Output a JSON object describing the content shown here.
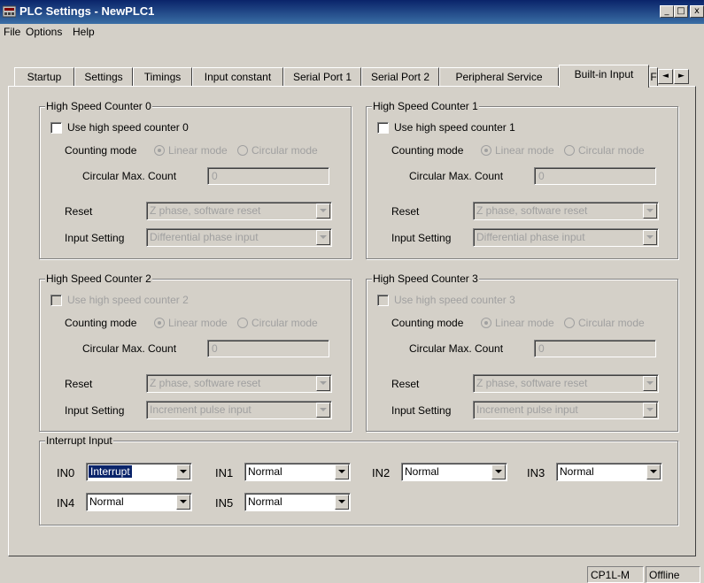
{
  "window": {
    "title": "PLC Settings - NewPLC1",
    "buttons": {
      "minimize": "_",
      "maximize": "□",
      "close": "x"
    }
  },
  "menu": {
    "items": [
      "File",
      "Options",
      "Help"
    ]
  },
  "tabs": [
    "Startup",
    "Settings",
    "Timings",
    "Input constant",
    "Serial Port 1",
    "Serial Port 2",
    "Peripheral Service",
    "Built-in Input",
    "F"
  ],
  "tab_scroll": {
    "left": "◄",
    "right": "►"
  },
  "counters": [
    {
      "legend": "High Speed Counter 0",
      "use_label": "Use high speed counter 0",
      "use_enabled": true,
      "counting_mode_label": "Counting mode",
      "linear_label": "Linear mode",
      "circular_label": "Circular mode",
      "max_count_label": "Circular Max. Count",
      "max_count_value": "0",
      "reset_label": "Reset",
      "reset_value": "Z phase, software reset",
      "input_setting_label": "Input Setting",
      "input_setting_value": "Differential phase input"
    },
    {
      "legend": "High Speed Counter 1",
      "use_label": "Use high speed counter 1",
      "use_enabled": true,
      "counting_mode_label": "Counting mode",
      "linear_label": "Linear mode",
      "circular_label": "Circular mode",
      "max_count_label": "Circular Max. Count",
      "max_count_value": "0",
      "reset_label": "Reset",
      "reset_value": "Z phase, software reset",
      "input_setting_label": "Input Setting",
      "input_setting_value": "Differential phase input"
    },
    {
      "legend": "High Speed Counter 2",
      "use_label": "Use high speed counter 2",
      "use_enabled": false,
      "counting_mode_label": "Counting mode",
      "linear_label": "Linear mode",
      "circular_label": "Circular mode",
      "max_count_label": "Circular Max. Count",
      "max_count_value": "0",
      "reset_label": "Reset",
      "reset_value": "Z phase, software reset",
      "input_setting_label": "Input Setting",
      "input_setting_value": "Increment pulse input"
    },
    {
      "legend": "High Speed Counter 3",
      "use_label": "Use high speed counter 3",
      "use_enabled": false,
      "counting_mode_label": "Counting mode",
      "linear_label": "Linear mode",
      "circular_label": "Circular mode",
      "max_count_label": "Circular Max. Count",
      "max_count_value": "0",
      "reset_label": "Reset",
      "reset_value": "Z phase, software reset",
      "input_setting_label": "Input Setting",
      "input_setting_value": "Increment pulse input"
    }
  ],
  "interrupt": {
    "legend": "Interrupt Input",
    "inputs": [
      {
        "label": "IN0",
        "value": "Interrupt"
      },
      {
        "label": "IN1",
        "value": "Normal"
      },
      {
        "label": "IN2",
        "value": "Normal"
      },
      {
        "label": "IN3",
        "value": "Normal"
      },
      {
        "label": "IN4",
        "value": "Normal"
      },
      {
        "label": "IN5",
        "value": "Normal"
      }
    ]
  },
  "status": {
    "model": "CP1L-M",
    "connection": "Offline"
  },
  "colors": {
    "titlebar": "#0a246a",
    "face": "#d4d0c8",
    "selection": "#0a246a"
  }
}
